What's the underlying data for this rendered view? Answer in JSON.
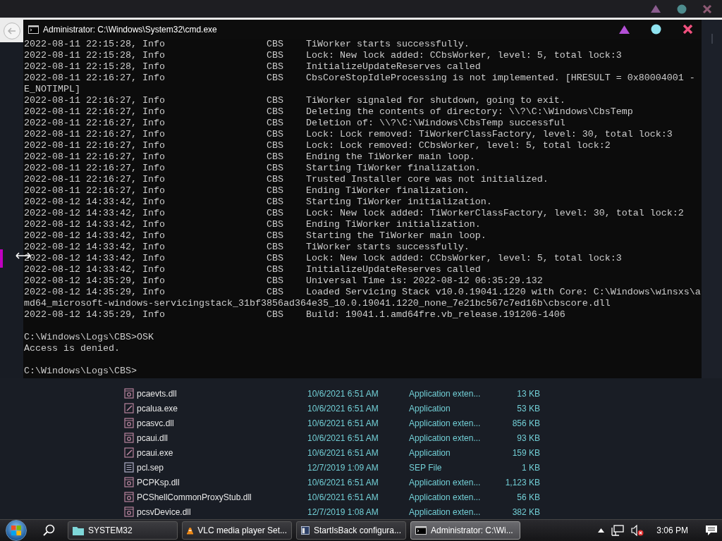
{
  "cmd_window": {
    "title": "Administrator: C:\\Windows\\System32\\cmd.exe",
    "log": [
      {
        "head": "2022-08-11 22:15:28, Info",
        "source": "CBS",
        "message": "TiWorker starts successfully."
      },
      {
        "head": "2022-08-11 22:15:28, Info",
        "source": "CBS",
        "message": "Lock: New lock added: CCbsWorker, level: 5, total lock:3"
      },
      {
        "head": "2022-08-11 22:15:28, Info",
        "source": "CBS",
        "message": "InitializeUpdateReserves called"
      },
      {
        "head": "2022-08-11 22:16:27, Info",
        "source": "CBS",
        "message": "CbsCoreStopIdleProcessing is not implemented. [HRESULT = 0x80004001 - E_NOTIMPL]"
      },
      {
        "head": "2022-08-11 22:16:27, Info",
        "source": "CBS",
        "message": "TiWorker signaled for shutdown, going to exit."
      },
      {
        "head": "2022-08-11 22:16:27, Info",
        "source": "CBS",
        "message": "Deleting the contents of directory: \\\\?\\C:\\Windows\\CbsTemp"
      },
      {
        "head": "2022-08-11 22:16:27, Info",
        "source": "CBS",
        "message": "Deletion of: \\\\?\\C:\\Windows\\CbsTemp successful"
      },
      {
        "head": "2022-08-11 22:16:27, Info",
        "source": "CBS",
        "message": "Lock: Lock removed: TiWorkerClassFactory, level: 30, total lock:3"
      },
      {
        "head": "2022-08-11 22:16:27, Info",
        "source": "CBS",
        "message": "Lock: Lock removed: CCbsWorker, level: 5, total lock:2"
      },
      {
        "head": "2022-08-11 22:16:27, Info",
        "source": "CBS",
        "message": "Ending the TiWorker main loop."
      },
      {
        "head": "2022-08-11 22:16:27, Info",
        "source": "CBS",
        "message": "Starting TiWorker finalization."
      },
      {
        "head": "2022-08-11 22:16:27, Info",
        "source": "CBS",
        "message": "Trusted Installer core was not initialized."
      },
      {
        "head": "2022-08-11 22:16:27, Info",
        "source": "CBS",
        "message": "Ending TiWorker finalization."
      },
      {
        "head": "2022-08-12 14:33:42, Info",
        "source": "CBS",
        "message": "Starting TiWorker initialization."
      },
      {
        "head": "2022-08-12 14:33:42, Info",
        "source": "CBS",
        "message": "Lock: New lock added: TiWorkerClassFactory, level: 30, total lock:2"
      },
      {
        "head": "2022-08-12 14:33:42, Info",
        "source": "CBS",
        "message": "Ending TiWorker initialization."
      },
      {
        "head": "2022-08-12 14:33:42, Info",
        "source": "CBS",
        "message": "Starting the TiWorker main loop."
      },
      {
        "head": "2022-08-12 14:33:42, Info",
        "source": "CBS",
        "message": "TiWorker starts successfully."
      },
      {
        "head": "2022-08-12 14:33:42, Info",
        "source": "CBS",
        "message": "Lock: New lock added: CCbsWorker, level: 5, total lock:3"
      },
      {
        "head": "2022-08-12 14:33:42, Info",
        "source": "CBS",
        "message": "InitializeUpdateReserves called"
      },
      {
        "head": "2022-08-12 14:35:29, Info",
        "source": "CBS",
        "message": "Universal Time is: 2022-08-12 06:35:29.132"
      },
      {
        "head": "2022-08-12 14:35:29, Info",
        "source": "CBS",
        "message": "Loaded Servicing Stack v10.0.19041.1220 with Core: C:\\Windows\\winsxs\\amd64_microsoft-windows-servicingstack_31bf3856ad364e35_10.0.19041.1220_none_7e21bc567c7ed16b\\cbscore.dll"
      },
      {
        "head": "2022-08-12 14:35:29, Info",
        "source": "CBS",
        "message": "Build: 19041.1.amd64fre.vb_release.191206-1406"
      }
    ],
    "output": [
      {
        "kind": "prompt",
        "text": "C:\\Windows\\Logs\\CBS>OSK"
      },
      {
        "kind": "text",
        "text": "Access is denied."
      },
      {
        "kind": "prompt",
        "text": "C:\\Windows\\Logs\\CBS>"
      }
    ]
  },
  "files": [
    {
      "kind": "dll",
      "name": "pcaevts.dll",
      "date": "10/6/2021 6:51 AM",
      "type": "Application exten...",
      "size": "13 KB"
    },
    {
      "kind": "exe",
      "name": "pcalua.exe",
      "date": "10/6/2021 6:51 AM",
      "type": "Application",
      "size": "53 KB"
    },
    {
      "kind": "dll",
      "name": "pcasvc.dll",
      "date": "10/6/2021 6:51 AM",
      "type": "Application exten...",
      "size": "856 KB"
    },
    {
      "kind": "dll",
      "name": "pcaui.dll",
      "date": "10/6/2021 6:51 AM",
      "type": "Application exten...",
      "size": "93 KB"
    },
    {
      "kind": "exe",
      "name": "pcaui.exe",
      "date": "10/6/2021 6:51 AM",
      "type": "Application",
      "size": "159 KB"
    },
    {
      "kind": "text",
      "name": "pcl.sep",
      "date": "12/7/2019 1:09 AM",
      "type": "SEP File",
      "size": "1 KB"
    },
    {
      "kind": "dll",
      "name": "PCPKsp.dll",
      "date": "10/6/2021 6:51 AM",
      "type": "Application exten...",
      "size": "1,123 KB"
    },
    {
      "kind": "dll",
      "name": "PCShellCommonProxyStub.dll",
      "date": "10/6/2021 6:51 AM",
      "type": "Application exten...",
      "size": "56 KB"
    },
    {
      "kind": "dll",
      "name": "pcsvDevice.dll",
      "date": "12/7/2019 1:08 AM",
      "type": "Application exten...",
      "size": "382 KB"
    }
  ],
  "taskbar": {
    "buttons": [
      {
        "kind": "folder",
        "label": "SYSTEM32",
        "selected": false
      },
      {
        "kind": "vlc",
        "label": "VLC media player Set...",
        "selected": false
      },
      {
        "kind": "app",
        "label": "StartIsBack configura...",
        "selected": false
      },
      {
        "kind": "cmd",
        "label": "Administrator: C:\\Wi...",
        "selected": true
      }
    ],
    "clock": "3:06 PM"
  }
}
